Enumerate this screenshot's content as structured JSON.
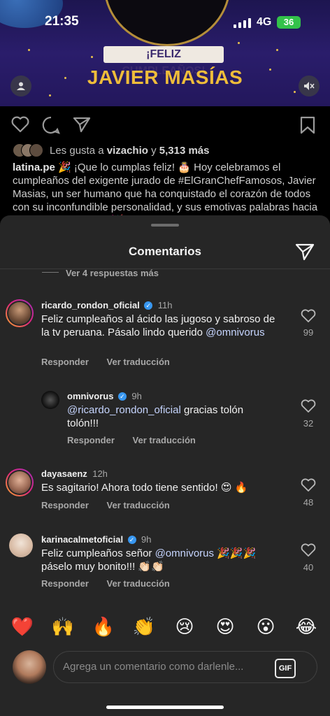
{
  "status": {
    "time": "21:35",
    "network": "4G",
    "battery": "36"
  },
  "post": {
    "banner": "¡FELIZ CUMPLEAÑOS!",
    "name_title": "JAVIER MASÍAS",
    "likes_prefix": "Les gusta a",
    "likes_user": "vizachio",
    "likes_mid": "y",
    "likes_count": "5,313 más",
    "caption_user": "latina.pe",
    "caption_text": "🎉 ¡Que lo cumplas feliz! 🎂 Hoy celebramos el cumpleaños del exigente jurado de #ElGranChefFamosos, Javier Masias, un ser humano que ha conquistado el corazón de todos con su inconfundible personalidad, y sus emotivas palabras hacia los concursantes 🫶 🥳"
  },
  "sheet": {
    "title": "Comentarios",
    "view_replies": "Ver 4 respuestas más"
  },
  "comments": [
    {
      "user": "ricardo_rondon_oficial",
      "time": "11h",
      "text": "Feliz cumpleaños al ácido las jugoso y sabroso de la tv peruana. Pásalo lindo querido ",
      "mention": "@omnivorus",
      "reply": "Responder",
      "translate": "Ver traducción",
      "likes": "99"
    },
    {
      "user": "omnivorus",
      "time": "9h",
      "mention": "@ricardo_rondon_oficial",
      "text": " gracias tolón tolón!!!",
      "reply": "Responder",
      "translate": "Ver traducción",
      "likes": "32"
    },
    {
      "user": "dayasaenz",
      "time": "12h",
      "text": "Es sagitario! Ahora todo tiene sentido! 😍 🔥",
      "reply": "Responder",
      "translate": "Ver traducción",
      "likes": "48"
    },
    {
      "user": "karinacalmetoficial",
      "time": "9h",
      "text_pre": "Feliz cumpleaños señor ",
      "mention": "@omnivorus",
      "text_post": " 🎉🎉🎉 páselo muy bonito!!! 👏🏻👏🏻",
      "reply": "Responder",
      "translate": "Ver traducción",
      "likes": "40"
    }
  ],
  "emojis": [
    "❤️",
    "🙌",
    "🔥",
    "👏",
    "😢",
    "😍",
    "😮",
    "😂"
  ],
  "composer": {
    "placeholder": "Agrega un comentario como darlenle...",
    "gif": "GIF"
  },
  "colors": {
    "sheet": "#262626",
    "accent_blue": "#3897f0",
    "mention": "#c6d5ff"
  }
}
